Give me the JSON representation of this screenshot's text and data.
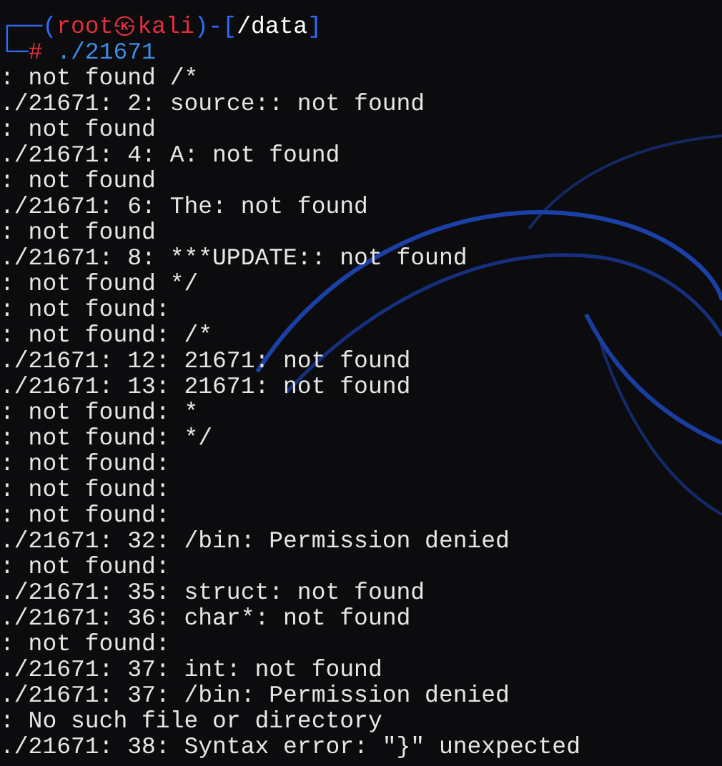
{
  "prompt": {
    "corner_top": "┌──",
    "open": "(",
    "user": "root",
    "at": "㉿",
    "host": "kali",
    "mid": ")-[",
    "path": "/data",
    "close": "]",
    "corner_bottom": "└─",
    "symbol": "#",
    "command": "./21671"
  },
  "output": [
    ": not found /*",
    "./21671: 2: source:: not found",
    ": not found",
    "./21671: 4: A: not found",
    ": not found",
    "./21671: 6: The: not found",
    ": not found",
    "./21671: 8: ***UPDATE:: not found",
    ": not found */",
    ": not found:",
    ": not found: /*",
    "./21671: 12: 21671: not found",
    "./21671: 13: 21671: not found",
    ": not found: *",
    ": not found: */",
    ": not found:",
    ": not found:",
    ": not found:",
    "./21671: 32: /bin: Permission denied",
    ": not found:",
    "./21671: 35: struct: not found",
    "./21671: 36: char*: not found",
    ": not found:",
    "./21671: 37: int: not found",
    "./21671: 37: /bin: Permission denied",
    ": No such file or directory",
    "./21671: 38: Syntax error: \"}\" unexpected"
  ]
}
